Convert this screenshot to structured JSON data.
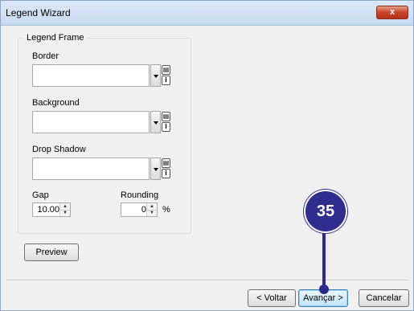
{
  "window": {
    "title": "Legend Wizard",
    "close_label": "x"
  },
  "legend_frame": {
    "title": "Legend Frame",
    "border": {
      "label": "Border",
      "value": ""
    },
    "background": {
      "label": "Background",
      "value": ""
    },
    "drop_shadow": {
      "label": "Drop Shadow",
      "value": ""
    },
    "gap": {
      "label": "Gap",
      "value": "10.00"
    },
    "rounding": {
      "label": "Rounding",
      "value": "0",
      "unit": "%"
    }
  },
  "buttons": {
    "preview": "Preview",
    "back": "< Voltar",
    "next": "Avançar >",
    "cancel": "Cancelar"
  },
  "callout": {
    "number": "35"
  },
  "icons": {
    "table_icon": "table-icon",
    "info_icon": "i"
  }
}
